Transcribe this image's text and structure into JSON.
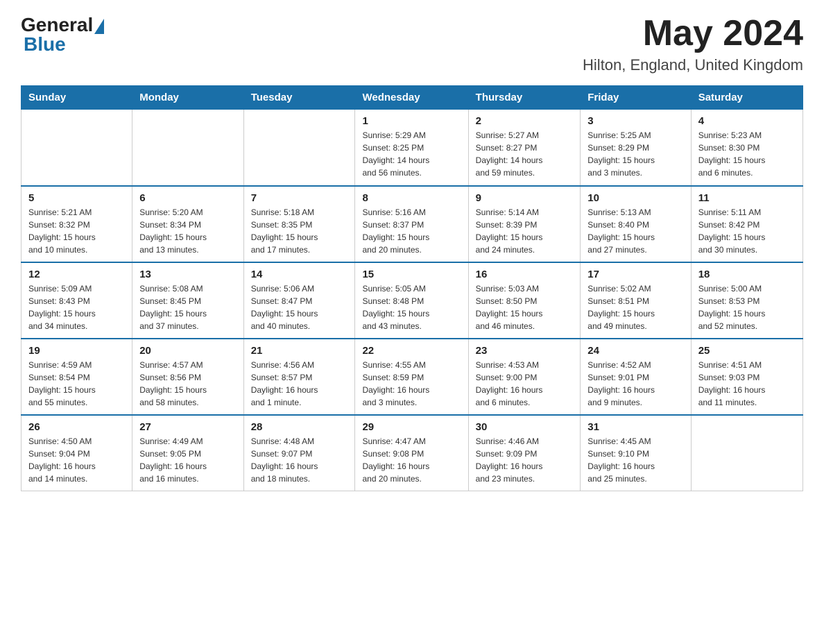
{
  "header": {
    "logo_general": "General",
    "logo_blue": "Blue",
    "month_title": "May 2024",
    "location": "Hilton, England, United Kingdom"
  },
  "days_of_week": [
    "Sunday",
    "Monday",
    "Tuesday",
    "Wednesday",
    "Thursday",
    "Friday",
    "Saturday"
  ],
  "weeks": [
    [
      {
        "day": "",
        "info": ""
      },
      {
        "day": "",
        "info": ""
      },
      {
        "day": "",
        "info": ""
      },
      {
        "day": "1",
        "info": "Sunrise: 5:29 AM\nSunset: 8:25 PM\nDaylight: 14 hours\nand 56 minutes."
      },
      {
        "day": "2",
        "info": "Sunrise: 5:27 AM\nSunset: 8:27 PM\nDaylight: 14 hours\nand 59 minutes."
      },
      {
        "day": "3",
        "info": "Sunrise: 5:25 AM\nSunset: 8:29 PM\nDaylight: 15 hours\nand 3 minutes."
      },
      {
        "day": "4",
        "info": "Sunrise: 5:23 AM\nSunset: 8:30 PM\nDaylight: 15 hours\nand 6 minutes."
      }
    ],
    [
      {
        "day": "5",
        "info": "Sunrise: 5:21 AM\nSunset: 8:32 PM\nDaylight: 15 hours\nand 10 minutes."
      },
      {
        "day": "6",
        "info": "Sunrise: 5:20 AM\nSunset: 8:34 PM\nDaylight: 15 hours\nand 13 minutes."
      },
      {
        "day": "7",
        "info": "Sunrise: 5:18 AM\nSunset: 8:35 PM\nDaylight: 15 hours\nand 17 minutes."
      },
      {
        "day": "8",
        "info": "Sunrise: 5:16 AM\nSunset: 8:37 PM\nDaylight: 15 hours\nand 20 minutes."
      },
      {
        "day": "9",
        "info": "Sunrise: 5:14 AM\nSunset: 8:39 PM\nDaylight: 15 hours\nand 24 minutes."
      },
      {
        "day": "10",
        "info": "Sunrise: 5:13 AM\nSunset: 8:40 PM\nDaylight: 15 hours\nand 27 minutes."
      },
      {
        "day": "11",
        "info": "Sunrise: 5:11 AM\nSunset: 8:42 PM\nDaylight: 15 hours\nand 30 minutes."
      }
    ],
    [
      {
        "day": "12",
        "info": "Sunrise: 5:09 AM\nSunset: 8:43 PM\nDaylight: 15 hours\nand 34 minutes."
      },
      {
        "day": "13",
        "info": "Sunrise: 5:08 AM\nSunset: 8:45 PM\nDaylight: 15 hours\nand 37 minutes."
      },
      {
        "day": "14",
        "info": "Sunrise: 5:06 AM\nSunset: 8:47 PM\nDaylight: 15 hours\nand 40 minutes."
      },
      {
        "day": "15",
        "info": "Sunrise: 5:05 AM\nSunset: 8:48 PM\nDaylight: 15 hours\nand 43 minutes."
      },
      {
        "day": "16",
        "info": "Sunrise: 5:03 AM\nSunset: 8:50 PM\nDaylight: 15 hours\nand 46 minutes."
      },
      {
        "day": "17",
        "info": "Sunrise: 5:02 AM\nSunset: 8:51 PM\nDaylight: 15 hours\nand 49 minutes."
      },
      {
        "day": "18",
        "info": "Sunrise: 5:00 AM\nSunset: 8:53 PM\nDaylight: 15 hours\nand 52 minutes."
      }
    ],
    [
      {
        "day": "19",
        "info": "Sunrise: 4:59 AM\nSunset: 8:54 PM\nDaylight: 15 hours\nand 55 minutes."
      },
      {
        "day": "20",
        "info": "Sunrise: 4:57 AM\nSunset: 8:56 PM\nDaylight: 15 hours\nand 58 minutes."
      },
      {
        "day": "21",
        "info": "Sunrise: 4:56 AM\nSunset: 8:57 PM\nDaylight: 16 hours\nand 1 minute."
      },
      {
        "day": "22",
        "info": "Sunrise: 4:55 AM\nSunset: 8:59 PM\nDaylight: 16 hours\nand 3 minutes."
      },
      {
        "day": "23",
        "info": "Sunrise: 4:53 AM\nSunset: 9:00 PM\nDaylight: 16 hours\nand 6 minutes."
      },
      {
        "day": "24",
        "info": "Sunrise: 4:52 AM\nSunset: 9:01 PM\nDaylight: 16 hours\nand 9 minutes."
      },
      {
        "day": "25",
        "info": "Sunrise: 4:51 AM\nSunset: 9:03 PM\nDaylight: 16 hours\nand 11 minutes."
      }
    ],
    [
      {
        "day": "26",
        "info": "Sunrise: 4:50 AM\nSunset: 9:04 PM\nDaylight: 16 hours\nand 14 minutes."
      },
      {
        "day": "27",
        "info": "Sunrise: 4:49 AM\nSunset: 9:05 PM\nDaylight: 16 hours\nand 16 minutes."
      },
      {
        "day": "28",
        "info": "Sunrise: 4:48 AM\nSunset: 9:07 PM\nDaylight: 16 hours\nand 18 minutes."
      },
      {
        "day": "29",
        "info": "Sunrise: 4:47 AM\nSunset: 9:08 PM\nDaylight: 16 hours\nand 20 minutes."
      },
      {
        "day": "30",
        "info": "Sunrise: 4:46 AM\nSunset: 9:09 PM\nDaylight: 16 hours\nand 23 minutes."
      },
      {
        "day": "31",
        "info": "Sunrise: 4:45 AM\nSunset: 9:10 PM\nDaylight: 16 hours\nand 25 minutes."
      },
      {
        "day": "",
        "info": ""
      }
    ]
  ]
}
